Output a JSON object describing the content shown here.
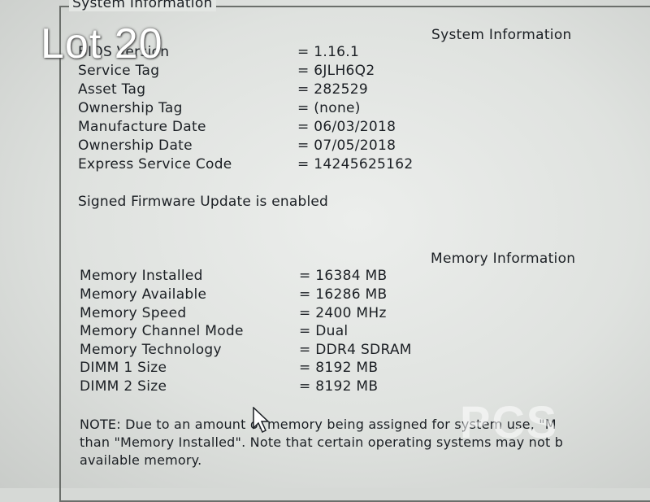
{
  "overlay": {
    "lot_label": "Lot 20"
  },
  "window": {
    "group_title": "System Information"
  },
  "system_info": {
    "title": "System Information",
    "rows": [
      {
        "label": "BIOS Version",
        "value": "= 1.16.1"
      },
      {
        "label": "Service Tag",
        "value": "= 6JLH6Q2"
      },
      {
        "label": "Asset Tag",
        "value": "= 282529"
      },
      {
        "label": "Ownership Tag",
        "value": "= (none)"
      },
      {
        "label": "Manufacture Date",
        "value": "= 06/03/2018"
      },
      {
        "label": "Ownership Date",
        "value": "= 07/05/2018"
      },
      {
        "label": "Express Service Code",
        "value": "= 14245625162"
      }
    ],
    "firmware_status": "Signed Firmware Update is enabled"
  },
  "memory_info": {
    "title": "Memory Information",
    "rows": [
      {
        "label": "Memory Installed",
        "value": "= 16384 MB"
      },
      {
        "label": "Memory Available",
        "value": "= 16286 MB"
      },
      {
        "label": "Memory Speed",
        "value": "= 2400 MHz"
      },
      {
        "label": "Memory Channel Mode",
        "value": "= Dual"
      },
      {
        "label": "Memory Technology",
        "value": "= DDR4 SDRAM"
      },
      {
        "label": "DIMM 1 Size",
        "value": "= 8192 MB"
      },
      {
        "label": "DIMM 2 Size",
        "value": "= 8192 MB"
      }
    ],
    "note_lines": [
      "NOTE: Due to an amount of memory being assigned for system use, \"M",
      "than \"Memory Installed\". Note that certain operating systems may not b",
      "available memory."
    ]
  },
  "watermark": {
    "text": "PCS"
  },
  "icons": {
    "cursor": "mouse-pointer-icon"
  }
}
